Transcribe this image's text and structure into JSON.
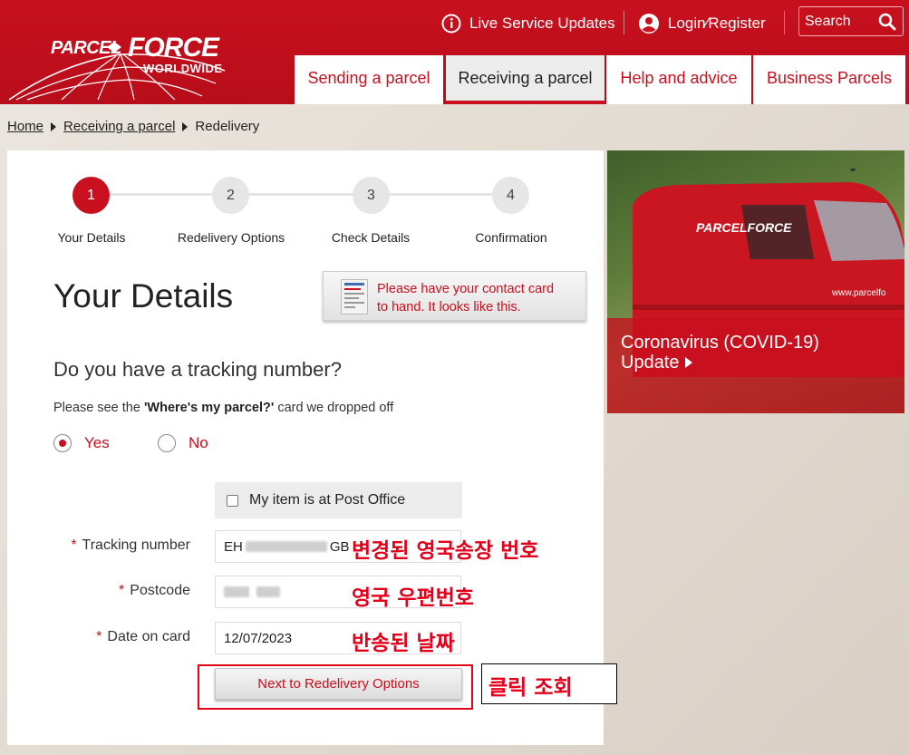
{
  "header": {
    "logo_parcel": "PARCEL",
    "logo_force": "FORCE",
    "logo_worldwide": "WORLDWIDE",
    "updates_label": "Live Service Updates",
    "login_label": "Login⁄Register",
    "search_label": "Search",
    "tabs": [
      {
        "label": "Sending a parcel"
      },
      {
        "label": "Receiving a parcel"
      },
      {
        "label": "Help and advice"
      },
      {
        "label": "Business Parcels"
      }
    ],
    "brand_color": "#c8101e"
  },
  "breadcrumb": {
    "home": "Home",
    "section": "Receiving a parcel",
    "current": "Redelivery"
  },
  "steps": [
    {
      "num": "1",
      "label": "Your Details"
    },
    {
      "num": "2",
      "label": "Redelivery Options"
    },
    {
      "num": "3",
      "label": "Check Details"
    },
    {
      "num": "4",
      "label": "Confirmation"
    }
  ],
  "form": {
    "title": "Your Details",
    "contact_card_line1": "Please have your contact card",
    "contact_card_line2": "to hand. It looks like this.",
    "question": "Do you have a tracking number?",
    "hint_prefix": "Please see the ",
    "hint_bold": "'Where's my parcel?'",
    "hint_suffix": " card we dropped off",
    "yes_label": "Yes",
    "no_label": "No",
    "post_office_label": "My item is at Post Office",
    "tracking_label": "Tracking number",
    "tracking_prefix": "EH",
    "tracking_suffix": "GB",
    "postcode_label": "Postcode",
    "date_label": "Date on card",
    "date_value": "12/07/2023",
    "required_mark": "*",
    "next_button": "Next to Redelivery Options"
  },
  "annotations": {
    "tracking": "변경된 영국송장 번호",
    "postcode": "영국 우편번호",
    "date": "반송된 날짜",
    "click": "클릭 조회"
  },
  "promo": {
    "line1": "Coronavirus (COVID-19)",
    "line2": "Update"
  }
}
